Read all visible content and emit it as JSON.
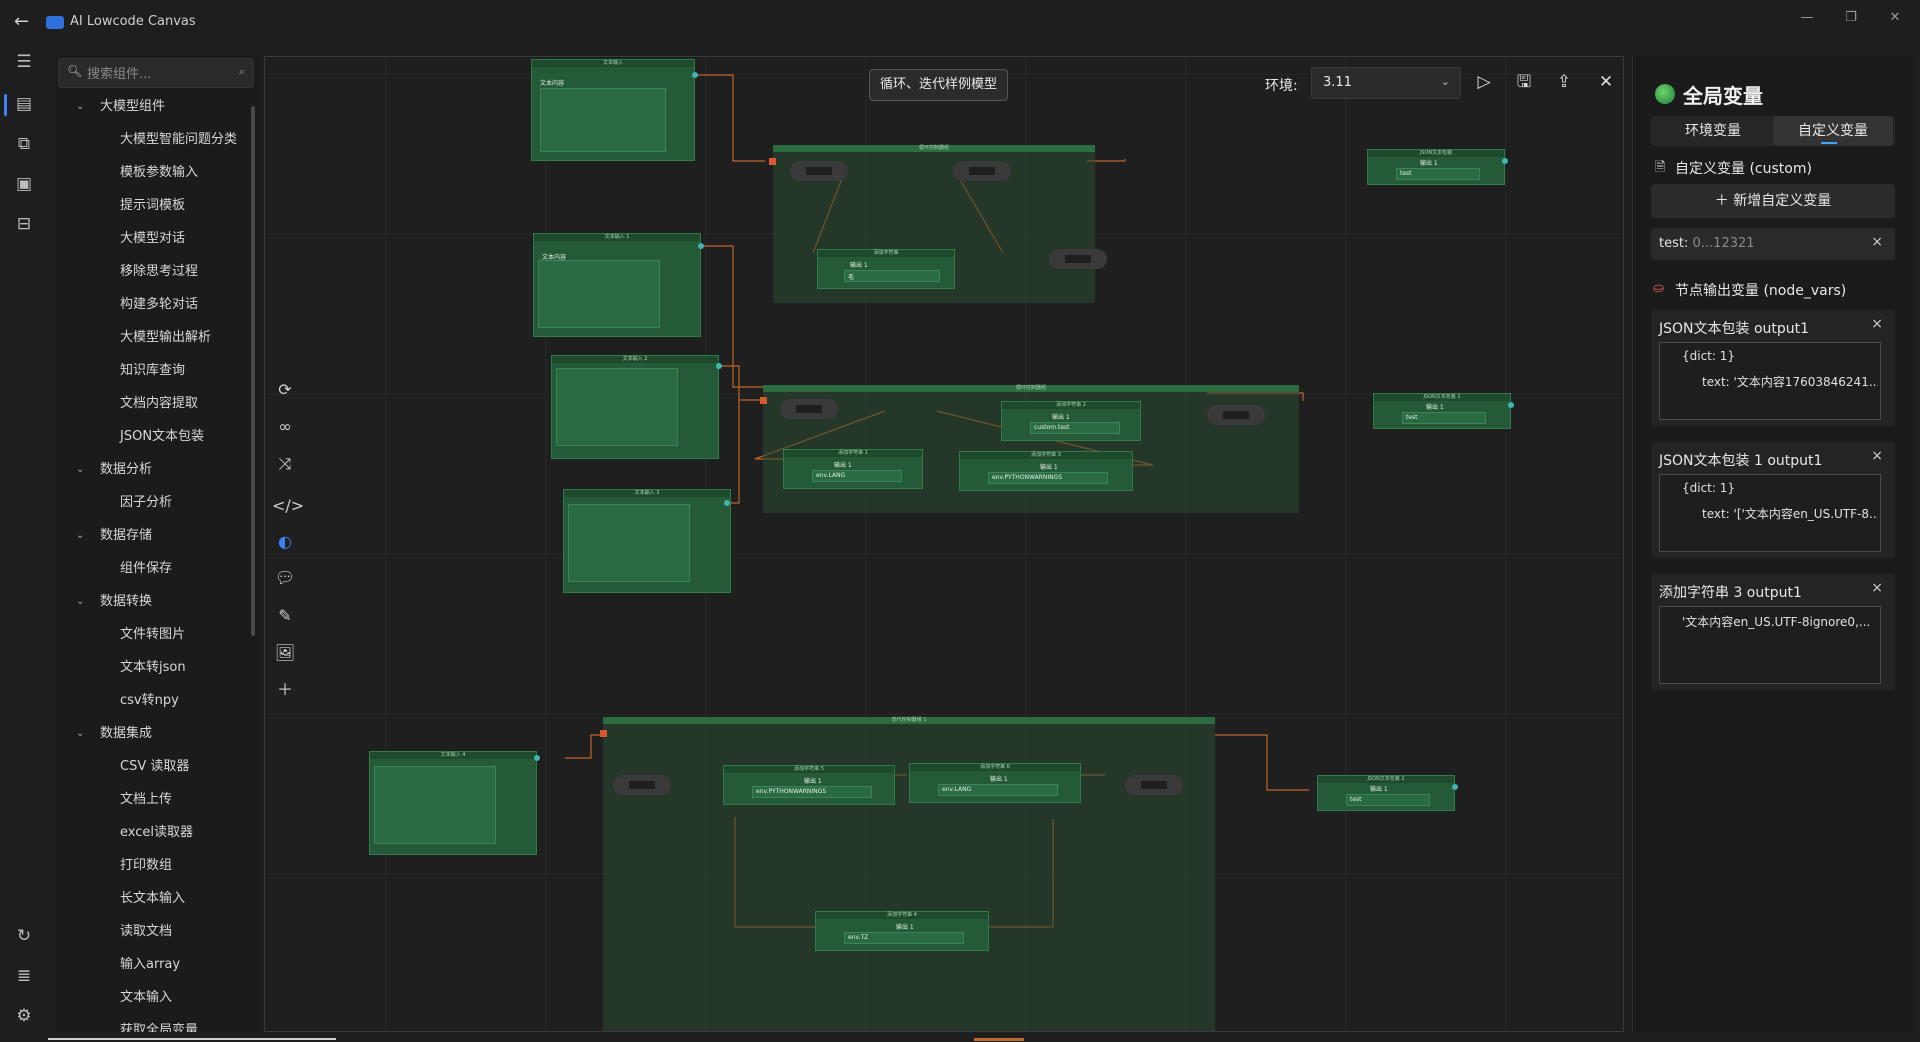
{
  "app": {
    "title": "AI Lowcode Canvas"
  },
  "window": {
    "minimize": "—",
    "restore": "❐",
    "close": "✕"
  },
  "search": {
    "placeholder": "搜索组件..."
  },
  "tree": [
    {
      "type": "cat",
      "label": "大模型组件"
    },
    {
      "type": "item",
      "label": "大模型智能问题分类"
    },
    {
      "type": "item",
      "label": "模板参数输入"
    },
    {
      "type": "item",
      "label": "提示词模板"
    },
    {
      "type": "item",
      "label": "大模型对话"
    },
    {
      "type": "item",
      "label": "移除思考过程"
    },
    {
      "type": "item",
      "label": "构建多轮对话"
    },
    {
      "type": "item",
      "label": "大模型输出解析"
    },
    {
      "type": "item",
      "label": "知识库查询"
    },
    {
      "type": "item",
      "label": "文档内容提取"
    },
    {
      "type": "item",
      "label": "JSON文本包装"
    },
    {
      "type": "cat",
      "label": "数据分析"
    },
    {
      "type": "item",
      "label": "因子分析"
    },
    {
      "type": "cat",
      "label": "数据存储"
    },
    {
      "type": "item",
      "label": "组件保存"
    },
    {
      "type": "cat",
      "label": "数据转换"
    },
    {
      "type": "item",
      "label": "文件转图片"
    },
    {
      "type": "item",
      "label": "文本转json"
    },
    {
      "type": "item",
      "label": "csv转npy"
    },
    {
      "type": "cat",
      "label": "数据集成"
    },
    {
      "type": "item",
      "label": "CSV 读取器"
    },
    {
      "type": "item",
      "label": "文档上传"
    },
    {
      "type": "item",
      "label": "excel读取器"
    },
    {
      "type": "item",
      "label": "打印数组"
    },
    {
      "type": "item",
      "label": "长文本输入"
    },
    {
      "type": "item",
      "label": "读取文档"
    },
    {
      "type": "item",
      "label": "输入array"
    },
    {
      "type": "item",
      "label": "文本输入"
    },
    {
      "type": "item",
      "label": "获取全局变量"
    }
  ],
  "canvas": {
    "workflow_title": "循环、迭代样例模型",
    "env_label": "环境:",
    "env_value": "3.11",
    "node_text": {
      "text_content": "文本内容",
      "env_lang": "env.LANG",
      "env_pythonwarnings": "env.PYTHONWARNINGS",
      "env_tz": "env.TZ",
      "custom_test": "custom.test",
      "test": "test",
      "hao": "毛"
    }
  },
  "right_panel": {
    "title": "全局变量",
    "tabs": [
      "环境变量",
      "自定义变量"
    ],
    "active_tab": 1,
    "custom_section": "自定义变量 (custom)",
    "add_button": "新增自定义变量",
    "custom_var": {
      "key": "test:",
      "value": "0...12321"
    },
    "node_section": "节点输出变量 (node_vars)",
    "cards": [
      {
        "title": "JSON文本包装 output1",
        "line1": "{dict: 1}",
        "line2": "text: '文本内容17603846241..."
      },
      {
        "title": "JSON文本包装 1 output1",
        "line1": "{dict: 1}",
        "line2": "text: '['文本内容en_US.UTF-8..."
      },
      {
        "title": "添加字符串 3 output1",
        "line1": "'文本内容en_US.UTF-8ignore0,...",
        "line2": ""
      }
    ]
  },
  "colors": {
    "accent": "#3b82f6",
    "node": "#245a37",
    "edge": "#c0652a",
    "port": "#3fb6b0"
  }
}
